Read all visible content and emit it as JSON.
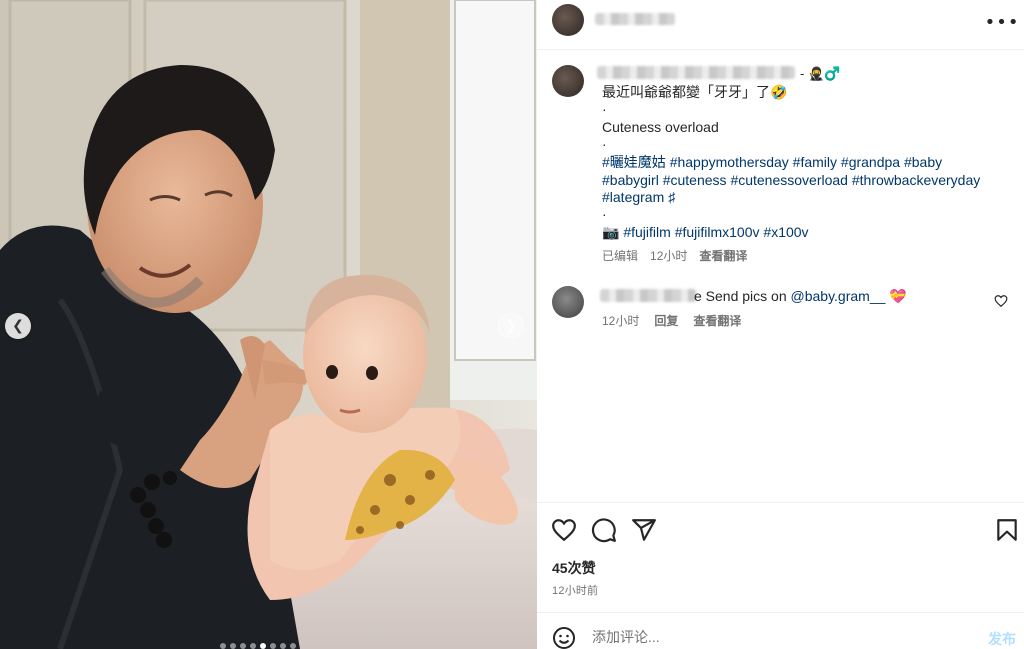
{
  "post": {
    "author_blurred": "",
    "icons": [
      "dots-horizontal-icon",
      "chevron-left-icon",
      "chevron-right-icon"
    ]
  },
  "caption": {
    "author_suffix": "-",
    "badge_emojis": "🥷♂️",
    "line1": "最近叫爺爺都變「牙牙」了🤣",
    "dot": "·",
    "line2": "Cuteness overload",
    "hashtags_row1": [
      "#曬娃魔姑",
      "#happymothersday",
      "#family",
      "#grandpa",
      "#baby"
    ],
    "hashtags_row2": [
      "#babygirl",
      "#cuteness",
      "#cutenessoverload",
      "#throwbackeveryday"
    ],
    "hashtags_row3": [
      "#lategram",
      "♯"
    ],
    "camera_emoji": "📷",
    "camera_tags": [
      "#fujifilm",
      "#fujifilmx100v",
      "#x100v"
    ],
    "edited": "已编辑",
    "time": "12小时",
    "translate": "查看翻译"
  },
  "comment": {
    "text_prefix": "e Send pics on ",
    "mention": "@baby.gram__",
    "emoji": "💝",
    "time": "12小时",
    "reply": "回复",
    "translate": "查看翻译"
  },
  "stats": {
    "likes": "45次赞",
    "posted": "12小时前"
  },
  "composer": {
    "placeholder": "添加评论...",
    "post_label": "发布"
  },
  "carousel": {
    "dot_count": 8,
    "active_index": 4,
    "prev": "❮",
    "next": "❯"
  },
  "colors": {
    "hashtag": "#00376b",
    "muted": "#737373",
    "post_button": "#b2dffc"
  }
}
